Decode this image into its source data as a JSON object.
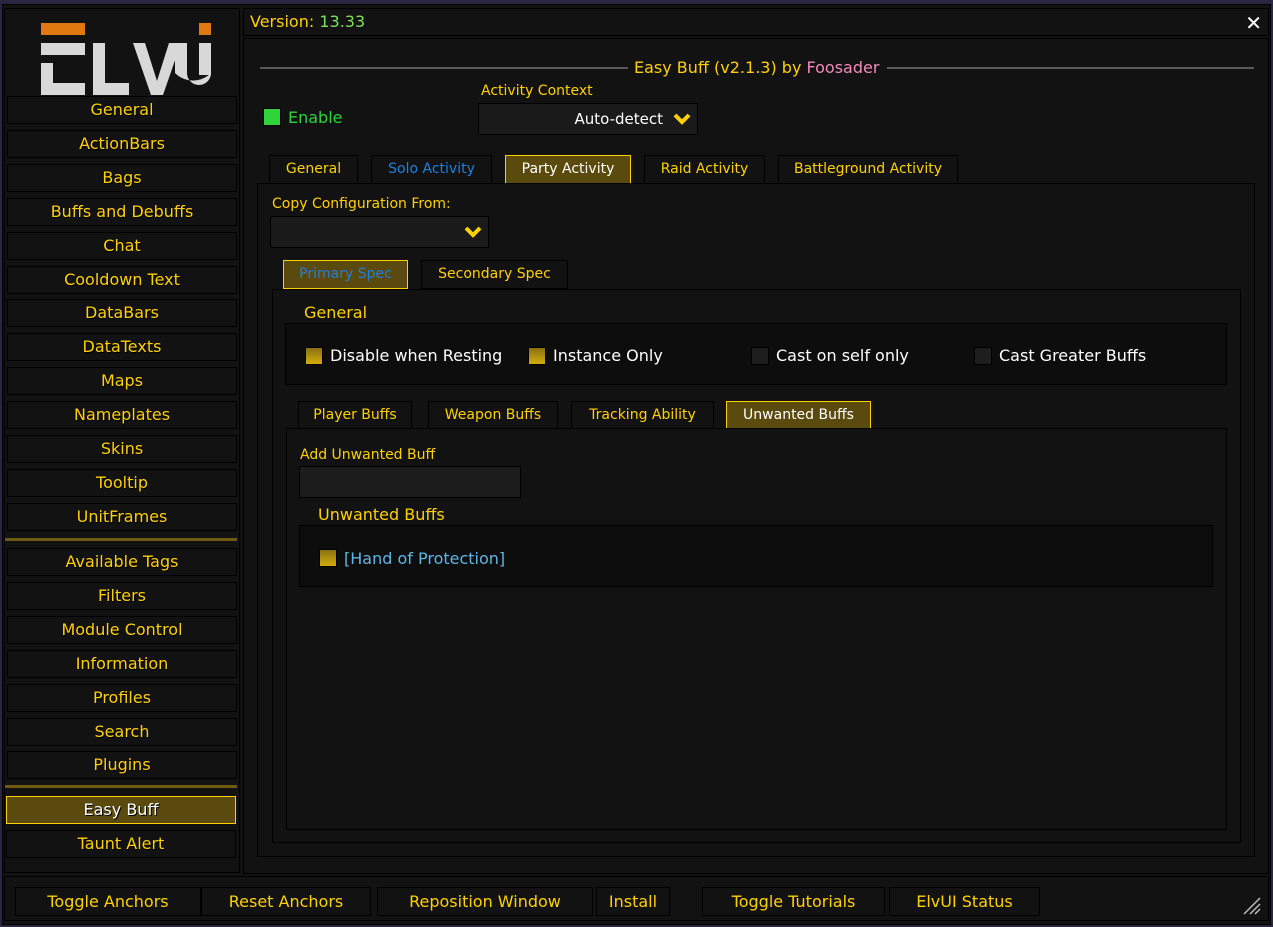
{
  "window": {
    "version_label": "Version:",
    "version_value": "13.33"
  },
  "sidebar": {
    "items": [
      {
        "label": "General"
      },
      {
        "label": "ActionBars"
      },
      {
        "label": "Bags"
      },
      {
        "label": "Buffs and Debuffs"
      },
      {
        "label": "Chat"
      },
      {
        "label": "Cooldown Text"
      },
      {
        "label": "DataBars"
      },
      {
        "label": "DataTexts"
      },
      {
        "label": "Maps"
      },
      {
        "label": "Nameplates"
      },
      {
        "label": "Skins"
      },
      {
        "label": "Tooltip"
      },
      {
        "label": "UnitFrames"
      }
    ],
    "items2": [
      {
        "label": "Available Tags"
      },
      {
        "label": "Filters"
      },
      {
        "label": "Module Control"
      },
      {
        "label": "Information"
      },
      {
        "label": "Profiles"
      },
      {
        "label": "Search"
      },
      {
        "label": "Plugins"
      }
    ],
    "plugins": [
      {
        "label": "Easy Buff",
        "active": true
      },
      {
        "label": "Taunt Alert",
        "active": false
      }
    ]
  },
  "header": {
    "title": "Easy Buff (v2.1.3) by ",
    "author": "Foosader"
  },
  "enable": {
    "label": "Enable",
    "checked": true
  },
  "activity_context": {
    "label": "Activity Context",
    "value": "Auto-detect"
  },
  "activity_tabs": [
    {
      "label": "General",
      "active": false
    },
    {
      "label": "Solo Activity",
      "active": false
    },
    {
      "label": "Party Activity",
      "active": true
    },
    {
      "label": "Raid Activity",
      "active": false
    },
    {
      "label": "Battleground Activity",
      "active": false
    }
  ],
  "copy_config": {
    "label": "Copy Configuration From:",
    "value": ""
  },
  "spec_tabs": [
    {
      "label": "Primary Spec",
      "active": true
    },
    {
      "label": "Secondary Spec",
      "active": false
    }
  ],
  "general_group": {
    "title": "General",
    "options": [
      {
        "label": "Disable when Resting",
        "checked": true
      },
      {
        "label": "Instance Only",
        "checked": true
      },
      {
        "label": "Cast on self only",
        "checked": false
      },
      {
        "label": "Cast Greater Buffs",
        "checked": false
      }
    ]
  },
  "buff_tabs": [
    {
      "label": "Player Buffs",
      "active": false
    },
    {
      "label": "Weapon Buffs",
      "active": false
    },
    {
      "label": "Tracking Ability",
      "active": false
    },
    {
      "label": "Unwanted Buffs",
      "active": true
    }
  ],
  "add_unwanted": {
    "label": "Add Unwanted Buff",
    "value": ""
  },
  "unwanted_group": {
    "title": "Unwanted Buffs",
    "items": [
      {
        "label": "[Hand of Protection]",
        "checked": true
      }
    ]
  },
  "bottom_buttons": [
    {
      "label": "Toggle Anchors"
    },
    {
      "label": "Reset Anchors"
    },
    {
      "label": "Reposition Window"
    },
    {
      "label": "Install"
    },
    {
      "label": "Toggle Tutorials"
    },
    {
      "label": "ElvUI Status"
    }
  ],
  "colors": {
    "accent": "#ffd100",
    "active_bg": "#5b4a0d",
    "enable_green": "#2fd33a",
    "author_pink": "#f28bbd",
    "link_blue": "#5fb6e6",
    "version_green": "#7ee05b"
  }
}
